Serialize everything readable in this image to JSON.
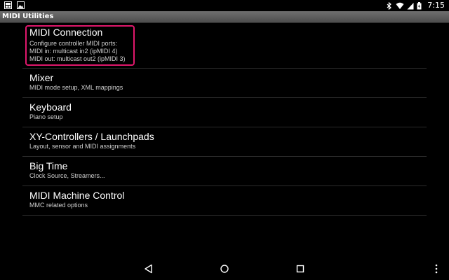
{
  "status_bar": {
    "time": "7:15",
    "left_icons": [
      "gallery-notification-icon",
      "image-notification-icon"
    ],
    "right_icons": [
      "bluetooth-icon",
      "wifi-icon",
      "cell-signal-icon",
      "battery-icon"
    ]
  },
  "action_bar": {
    "title": "MIDI Utilities"
  },
  "settings": [
    {
      "title": "MIDI Connection",
      "summary_lines": [
        "Configure controller MIDI ports:",
        "MIDI in: multicast in2 (ipMIDI 4)",
        "MIDI out: multicast out2 (ipMIDI 3)"
      ],
      "highlighted": true
    },
    {
      "title": "Mixer",
      "summary_lines": [
        "MIDI mode setup, XML mappings"
      ]
    },
    {
      "title": "Keyboard",
      "summary_lines": [
        "Piano setup"
      ]
    },
    {
      "title": "XY-Controllers / Launchpads",
      "summary_lines": [
        "Layout, sensor and MIDI assignments"
      ]
    },
    {
      "title": "Big Time",
      "summary_lines": [
        "Clock Source, Streamers..."
      ]
    },
    {
      "title": "MIDI Machine Control",
      "summary_lines": [
        "MMC related options"
      ]
    }
  ],
  "nav_bar": {
    "buttons": [
      "back-icon",
      "home-icon",
      "recents-icon",
      "overflow-menu-icon"
    ]
  },
  "colors": {
    "background": "#000000",
    "highlight": "#e0186c",
    "action_bar": "#5a5a5a",
    "divider": "#2b2b2b",
    "summary_text": "#cfcfcf"
  }
}
